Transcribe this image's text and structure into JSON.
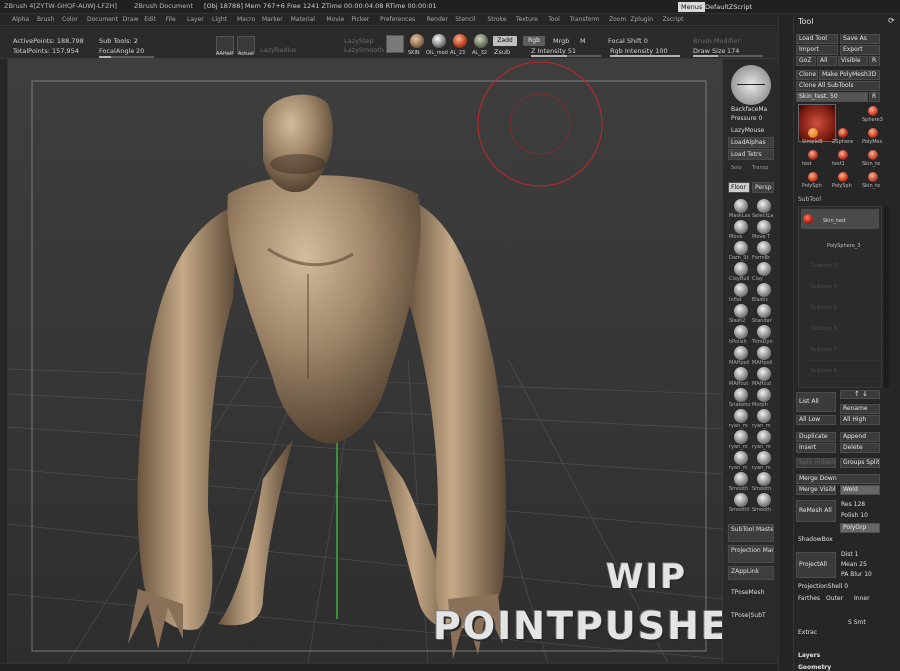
{
  "titlebar": {
    "app_title": "ZBrush 4[ZYTW-GHQF-AUWJ-LFZH]",
    "document": "ZBrush Document",
    "stats": "[Obj 18788] Mem 767+6 Free 1241 ZTime 00:00:04.08 RTime 00:00:01",
    "menus_btn": "Menus",
    "script_btn": "DefaultZScript"
  },
  "menubar": [
    "Alpha",
    "Brush",
    "Color",
    "Document",
    "Draw",
    "Edit",
    "File",
    "Layer",
    "Light",
    "Macro",
    "Marker",
    "Material",
    "Movie",
    "Picker",
    "Preferences",
    "Render",
    "Stencil",
    "Stroke",
    "Texture",
    "Tool",
    "Transform",
    "Zoom",
    "Zplugin",
    "Zscript"
  ],
  "topshelf": {
    "active_points": "ActivePoints: 188,798",
    "total_points": "TotalPoints: 157,954",
    "subtools": "Sub Tools: 2",
    "focal_angle_label": "FocalAngle",
    "focal_angle_value": "20",
    "aahalf": "AAHalf",
    "actual": "Actual",
    "lazy_radius": "LazyRadius",
    "lazy_step": "LazyStep",
    "lazy_smooth": "LazySmooth",
    "materials": [
      "SKIN",
      "OIL_mod",
      "AL_23",
      "AL_32",
      "AL_17"
    ],
    "zadd": "Zadd",
    "zsub": "Zsub",
    "rgb": "Rgb",
    "mrgb": "Mrgb",
    "m": "M",
    "z_intensity": "Z Intensity 51",
    "focal_shift": "Focal Shift 0",
    "rgb_intensity": "Rgb Intensity 100",
    "brush_modifier": "Brush Modifier",
    "draw_size_label": "Draw Size",
    "draw_size_value": "174",
    "z_intensity_level": 0.51,
    "rgb_intensity_level": 1.0,
    "draw_size_level": 0.35
  },
  "rightshelf": {
    "backface_mask": "BackfaceMa",
    "pressure": "Pressure 0",
    "lazy_mouse": "LazyMouse",
    "load_alphas": "LoadAlphas",
    "load_tetrs": "Load Tetrs",
    "solo": "Solo",
    "transp": "Transp",
    "floor": "Floor",
    "persp": "Persp",
    "brushes": [
      [
        "MaskLas",
        "SelectLa"
      ],
      [
        "Move",
        "Move T"
      ],
      [
        "Dam_St",
        "FormBr"
      ],
      [
        "ClayBuil",
        "Clay"
      ],
      [
        "Inflat",
        "Elastic"
      ],
      [
        "Slash2",
        "Standar"
      ],
      [
        "hPolish",
        "TrimDyn"
      ],
      [
        "MAHpoli",
        "MAHpoli"
      ],
      [
        "MAHcut",
        "MAHcut"
      ],
      [
        "Snakeho",
        "Morph"
      ],
      [
        "ryan_m",
        "ryan_m"
      ],
      [
        "ryan_m",
        "ryan_m"
      ],
      [
        "ryan_m",
        "ryan_m"
      ],
      [
        "Smooth",
        "Smooth"
      ],
      [
        "Smoothl",
        "Smooth"
      ]
    ],
    "subtool_master": "SubTool Master",
    "projection_master": "Projection Master",
    "zapplink": "ZAppLink",
    "tposemesh": "TPoseMesh",
    "tpose_subt": "TPose|SubT"
  },
  "toolpanel": {
    "title": "Tool",
    "load_tool": "Load Tool",
    "save_as": "Save As",
    "import": "Import",
    "export": "Export",
    "goz": "GoZ",
    "all": "All",
    "visible": "Visible",
    "r": "R",
    "clone": "Clone",
    "make_polymesh": "Make PolyMesh3D",
    "clone_all": "Clone All SubTools",
    "current_tool": "Skin_test. 50",
    "tools": [
      {
        "name": "Skin_test",
        "color": "#b33a2a"
      },
      {
        "name": "Sphere3",
        "color": "#c0301a"
      },
      {
        "name": "SimpleB",
        "color": "#e68a10"
      },
      {
        "name": "ZSphere",
        "color": "#b02010"
      },
      {
        "name": "PolyMes",
        "color": "#c03010"
      },
      {
        "name": "test",
        "color": "#b02a1a"
      },
      {
        "name": "test1",
        "color": "#b02a1a"
      },
      {
        "name": "Skin_te",
        "color": "#b33a2a"
      },
      {
        "name": "PolySph",
        "color": "#c03010"
      },
      {
        "name": "PolySph",
        "color": "#c03010"
      },
      {
        "name": "Skin_te",
        "color": "#b33a2a"
      }
    ],
    "subtool": "SubTool",
    "subtool_items": [
      "Skin_test",
      "PolySphere_3"
    ],
    "empty_slots": [
      "Subtool 3",
      "Subtool 4",
      "Subtool 5",
      "Subtool 6",
      "Subtool 7",
      "Subtool 8"
    ],
    "list_all": "List All",
    "rename": "Rename",
    "all_low": "All Low",
    "all_high": "All High",
    "duplicate": "Duplicate",
    "append": "Append",
    "insert": "Insert",
    "delete": "Delete",
    "split_hidden": "Split Hidden",
    "groups_split": "Groups Split",
    "merge_down": "Merge Down",
    "merge_visible": "Merge Visibl",
    "weld": "Weld",
    "remesh_all": "ReMesh All",
    "res": "Res 128",
    "polish": "Polish 10",
    "polygrp": "PolyGrp",
    "shadowbox": "ShadowBox",
    "project_all": "ProjectAll",
    "dist": "Dist 1",
    "mean": "Mean 25",
    "pa_blur": "PA Blur 10",
    "projection_shell": "ProjectionShell 0",
    "farthest": "Farthes",
    "outer": "Outer",
    "inner": "Inner",
    "extract": "Extrac",
    "s_smt": "S Smt",
    "layers": "Layers",
    "geometry": "Geometry"
  },
  "watermark": {
    "line1": "WIP",
    "line2": "POINTPUSHER.COM"
  },
  "colors": {
    "skin": "#a0866a",
    "brush_cursor": "#c0262a",
    "axis_green": "#3fcf3f",
    "accent": "#e6e6e6"
  }
}
